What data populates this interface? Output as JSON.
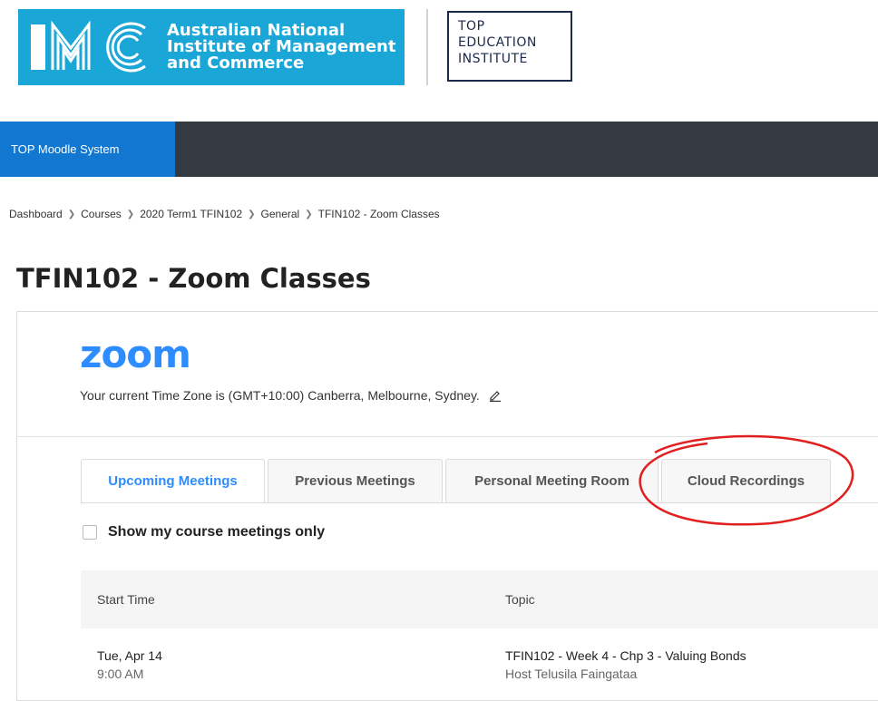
{
  "header": {
    "imc_logo": {
      "mark": "IMC",
      "line1": "Australian National",
      "line2": "Institute of Management",
      "line3": "and Commerce"
    },
    "top_logo": {
      "line1": "TOP",
      "line2": "EDUCATION",
      "line3": "INSTITUTE"
    },
    "colors": {
      "imc_blue": "#1aa6d6",
      "top_navy": "#1b2a4a"
    }
  },
  "navbar": {
    "brand": "TOP Moodle System",
    "colors": {
      "bar": "#343a40",
      "brand_bg": "#1177d1"
    }
  },
  "breadcrumb": {
    "items": [
      "Dashboard",
      "Courses",
      "2020 Term1 TFIN102",
      "General",
      "TFIN102 - Zoom Classes"
    ],
    "separator_icon": "chevron-right-icon"
  },
  "page": {
    "title": "TFIN102 - Zoom Classes"
  },
  "zoom": {
    "logo": "zoom",
    "timezone_text": "Your current Time Zone is (GMT+10:00) Canberra, Melbourne, Sydney.",
    "edit_icon": "pencil-icon",
    "accent": "#2d8cff",
    "tabs": [
      {
        "label": "Upcoming Meetings",
        "active": true
      },
      {
        "label": "Previous Meetings",
        "active": false
      },
      {
        "label": "Personal Meeting Room",
        "active": false
      },
      {
        "label": "Cloud Recordings",
        "active": false
      }
    ],
    "filter_checkbox": {
      "label": "Show my course meetings only",
      "checked": false
    },
    "table": {
      "columns": [
        "Start Time",
        "Topic"
      ],
      "rows": [
        {
          "date": "Tue, Apr 14",
          "time": "9:00 AM",
          "topic": "TFIN102 - Week 4 - Chp 3 - Valuing Bonds",
          "host": "Host Telusila Faingataa"
        }
      ]
    }
  },
  "annotation": {
    "shape": "ellipse",
    "color": "#e02020"
  }
}
